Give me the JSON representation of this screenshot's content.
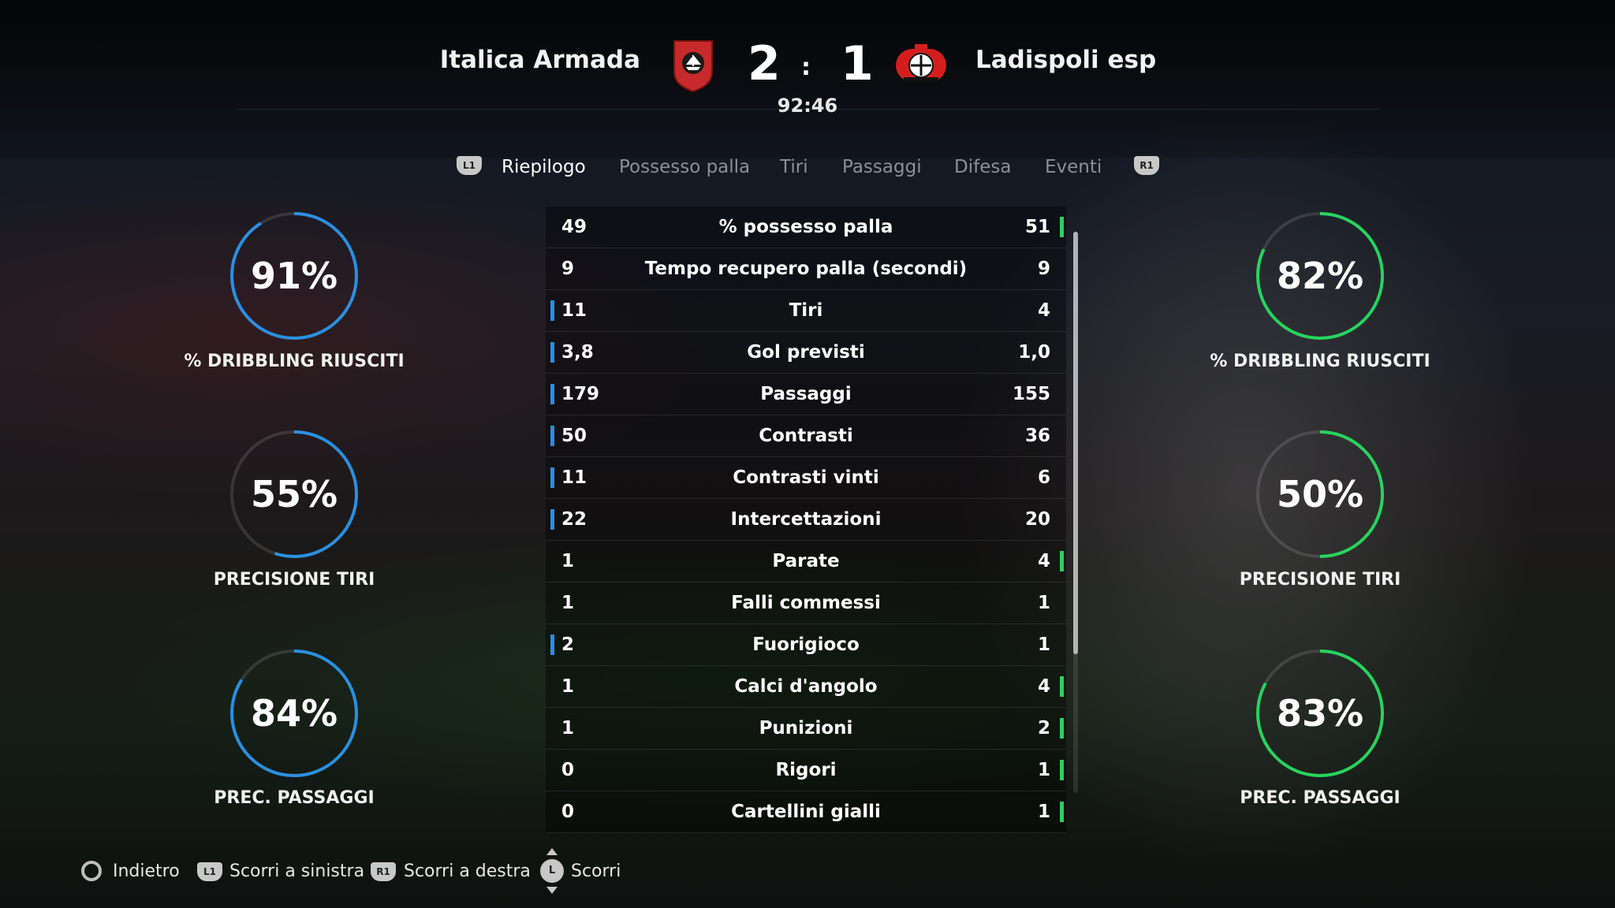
{
  "match": {
    "home_team": "Italica Armada",
    "away_team": "Ladispoli esp",
    "home_score": "2",
    "away_score": "1",
    "separator": ":",
    "clock": "92:46"
  },
  "tabs": {
    "left_button": "L1",
    "right_button": "R1",
    "items": [
      "Riepilogo",
      "Possesso palla",
      "Tiri",
      "Passaggi",
      "Difesa",
      "Eventi"
    ],
    "active": "Riepilogo"
  },
  "colors": {
    "home_accent": "#2a8fe0",
    "away_accent": "#27d35d"
  },
  "home_rings": [
    {
      "value": "91%",
      "percent": 91,
      "label": "% DRIBBLING RIUSCITI"
    },
    {
      "value": "55%",
      "percent": 55,
      "label": "PRECISIONE TIRI"
    },
    {
      "value": "84%",
      "percent": 84,
      "label": "PREC. PASSAGGI"
    }
  ],
  "away_rings": [
    {
      "value": "82%",
      "percent": 82,
      "label": "% DRIBBLING RIUSCITI"
    },
    {
      "value": "50%",
      "percent": 50,
      "label": "PRECISIONE TIRI"
    },
    {
      "value": "83%",
      "percent": 83,
      "label": "PREC. PASSAGGI"
    }
  ],
  "stats": [
    {
      "name": "% possesso palla",
      "home": "49",
      "away": "51",
      "leader": "away"
    },
    {
      "name": "Tempo recupero palla (secondi)",
      "home": "9",
      "away": "9",
      "leader": "none"
    },
    {
      "name": "Tiri",
      "home": "11",
      "away": "4",
      "leader": "home"
    },
    {
      "name": "Gol previsti",
      "home": "3,8",
      "away": "1,0",
      "leader": "home"
    },
    {
      "name": "Passaggi",
      "home": "179",
      "away": "155",
      "leader": "home"
    },
    {
      "name": "Contrasti",
      "home": "50",
      "away": "36",
      "leader": "home"
    },
    {
      "name": "Contrasti vinti",
      "home": "11",
      "away": "6",
      "leader": "home"
    },
    {
      "name": "Intercettazioni",
      "home": "22",
      "away": "20",
      "leader": "home"
    },
    {
      "name": "Parate",
      "home": "1",
      "away": "4",
      "leader": "away"
    },
    {
      "name": "Falli commessi",
      "home": "1",
      "away": "1",
      "leader": "none"
    },
    {
      "name": "Fuorigioco",
      "home": "2",
      "away": "1",
      "leader": "home"
    },
    {
      "name": "Calci d'angolo",
      "home": "1",
      "away": "4",
      "leader": "away"
    },
    {
      "name": "Punizioni",
      "home": "1",
      "away": "2",
      "leader": "away"
    },
    {
      "name": "Rigori",
      "home": "0",
      "away": "1",
      "leader": "away"
    },
    {
      "name": "Cartellini gialli",
      "home": "0",
      "away": "1",
      "leader": "away"
    }
  ],
  "footer": {
    "back": "Indietro",
    "scroll_left_badge": "L1",
    "scroll_left": "Scorri a sinistra",
    "scroll_right_badge": "R1",
    "scroll_right": "Scorri a destra",
    "scroll_badge": "L",
    "scroll": "Scorri"
  }
}
